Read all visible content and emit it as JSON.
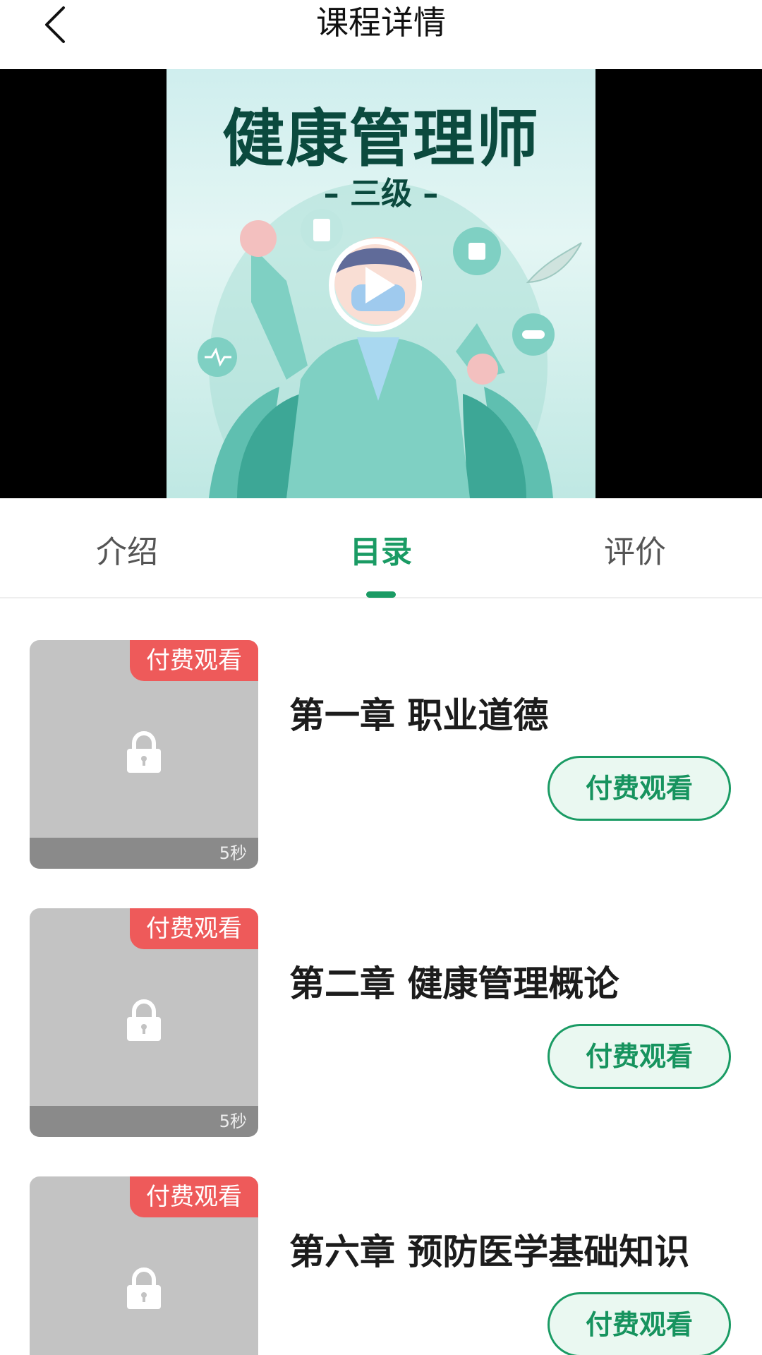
{
  "header": {
    "title": "课程详情",
    "back_icon": "chevron-left-icon"
  },
  "video": {
    "poster_title": "健康管理师",
    "poster_subtitle": "– 三级 –",
    "play_icon": "play-icon"
  },
  "tabs": [
    {
      "label": "介绍",
      "active": false
    },
    {
      "label": "目录",
      "active": true
    },
    {
      "label": "评价",
      "active": false
    }
  ],
  "colors": {
    "accent": "#1a9b64",
    "badge": "#ee5a5a",
    "thumb_bg": "#c3c3c3"
  },
  "chapters": [
    {
      "title": "第一章 职业道德",
      "badge": "付费观看",
      "duration": "5秒",
      "button": "付费观看",
      "icon": "lock-icon"
    },
    {
      "title": "第二章 健康管理概论",
      "badge": "付费观看",
      "duration": "5秒",
      "button": "付费观看",
      "icon": "lock-icon"
    },
    {
      "title": "第六章 预防医学基础知识",
      "badge": "付费观看",
      "duration": "",
      "button": "付费观看",
      "icon": "lock-icon"
    }
  ]
}
